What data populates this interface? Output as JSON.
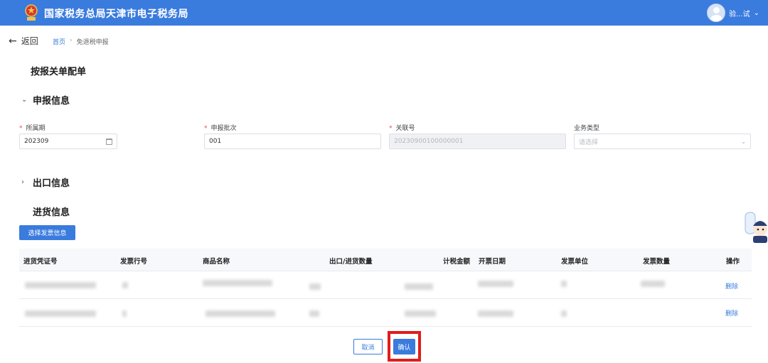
{
  "header": {
    "title": "国家税务总局天津市电子税务局",
    "user_name": "验...试"
  },
  "nav": {
    "back_label": "返回",
    "breadcrumb": [
      "首页",
      "免退税申报"
    ]
  },
  "page_title": "按报关单配单",
  "sections": {
    "declare": "申报信息",
    "export": "出口信息",
    "purchase": "进货信息"
  },
  "form": {
    "period": {
      "label": "所属期",
      "value": "202309"
    },
    "batch": {
      "label": "申报批次",
      "value": "001"
    },
    "link_no": {
      "label": "关联号",
      "value": "20230900100000001"
    },
    "biz_type": {
      "label": "业务类型",
      "placeholder": "请选择"
    }
  },
  "select_invoice_button": "选择发票信息",
  "table": {
    "columns": [
      "进货凭证号",
      "发票行号",
      "商品名称",
      "出口/进货数量",
      "计税金额",
      "开票日期",
      "发票单位",
      "发票数量",
      "操作"
    ],
    "rows": [
      {
        "action": "删除"
      },
      {
        "action": "删除"
      }
    ]
  },
  "footer": {
    "cancel": "取消",
    "confirm": "确认"
  },
  "colors": {
    "primary": "#3a7bde",
    "highlight": "#e11c1c"
  }
}
